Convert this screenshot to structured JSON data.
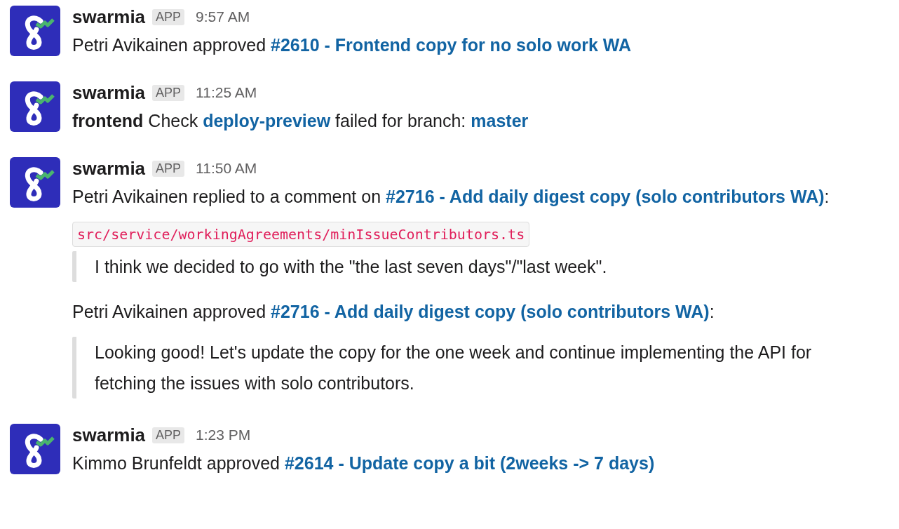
{
  "messages": [
    {
      "sender": "swarmia",
      "badge": "APP",
      "time": "9:57 AM",
      "blocks": [
        {
          "kind": "text",
          "parts": [
            {
              "kind": "plain",
              "text": "Petri Avikainen approved "
            },
            {
              "kind": "link",
              "text": "#2610 - Frontend copy for no solo work WA"
            }
          ]
        }
      ]
    },
    {
      "sender": "swarmia",
      "badge": "APP",
      "time": "11:25 AM",
      "blocks": [
        {
          "kind": "text",
          "parts": [
            {
              "kind": "bold",
              "text": "frontend"
            },
            {
              "kind": "plain",
              "text": " Check "
            },
            {
              "kind": "link",
              "text": "deploy-preview"
            },
            {
              "kind": "plain",
              "text": " failed for branch: "
            },
            {
              "kind": "link",
              "text": "master"
            }
          ]
        }
      ]
    },
    {
      "sender": "swarmia",
      "badge": "APP",
      "time": "11:50 AM",
      "blocks": [
        {
          "kind": "text",
          "parts": [
            {
              "kind": "plain",
              "text": "Petri Avikainen replied to a comment on "
            },
            {
              "kind": "link",
              "text": "#2716 - Add daily digest copy (solo contributors WA)"
            },
            {
              "kind": "plain",
              "text": ":"
            }
          ]
        },
        {
          "kind": "code",
          "text": "src/service/workingAgreements/minIssueContributors.ts"
        },
        {
          "kind": "quote",
          "text": "I think we decided to go with the \"the last seven days\"/\"last week\"."
        },
        {
          "kind": "text",
          "parts": [
            {
              "kind": "plain",
              "text": "Petri Avikainen approved "
            },
            {
              "kind": "link",
              "text": "#2716 - Add daily digest copy (solo contributors WA)"
            },
            {
              "kind": "plain",
              "text": ":"
            }
          ]
        },
        {
          "kind": "quote",
          "text": "Looking good! Let's update the copy for the one week and continue implementing the API for fetching the issues with solo contributors."
        }
      ]
    },
    {
      "sender": "swarmia",
      "badge": "APP",
      "time": "1:23 PM",
      "blocks": [
        {
          "kind": "text",
          "parts": [
            {
              "kind": "plain",
              "text": "Kimmo Brunfeldt approved "
            },
            {
              "kind": "link",
              "text": "#2614 - Update copy a bit (2weeks -> 7 days)"
            }
          ]
        }
      ]
    }
  ]
}
